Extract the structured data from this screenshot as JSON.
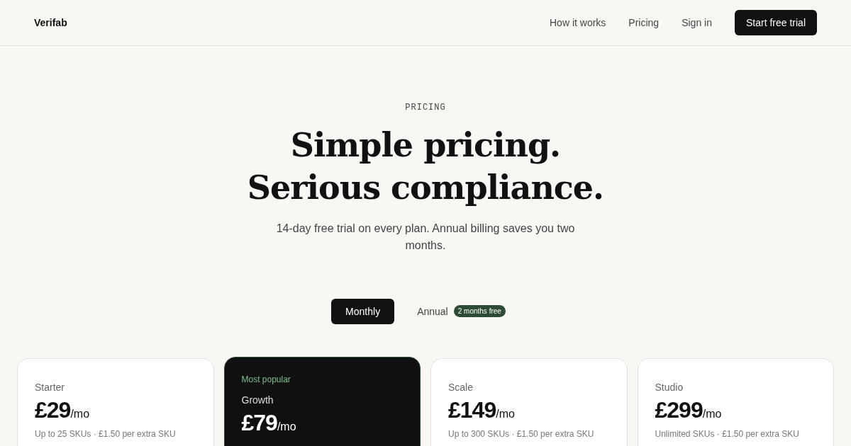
{
  "header": {
    "logo": "Verifab",
    "nav": [
      "How it works",
      "Pricing",
      "Sign in"
    ],
    "cta": "Start free trial"
  },
  "hero": {
    "eyebrow": "PRICING",
    "title_lines": [
      "Simple pricing.",
      "Serious compliance."
    ],
    "subtitle": "14-day free trial on every plan. Annual billing saves you two months."
  },
  "billing_tabs": [
    {
      "label": "Monthly",
      "selected": true
    },
    {
      "label": "Annual",
      "selected": false,
      "badge": "2 months free"
    }
  ],
  "plans": [
    {
      "name": "Starter",
      "featured": false,
      "price": "£29",
      "period": "/mo",
      "note": "Up to 25 SKUs · £1.50 per extra SKU"
    },
    {
      "name": "Growth",
      "featured": true,
      "tag": "Most popular",
      "price": "£79",
      "period": "/mo"
    },
    {
      "name": "Scale",
      "featured": false,
      "price": "£149",
      "period": "/mo",
      "note": "Up to 300 SKUs · £1.50 per extra SKU"
    },
    {
      "name": "Studio",
      "featured": false,
      "price": "£299",
      "period": "/mo",
      "note": "Unlimited SKUs · £1.50 per extra SKU"
    }
  ]
}
